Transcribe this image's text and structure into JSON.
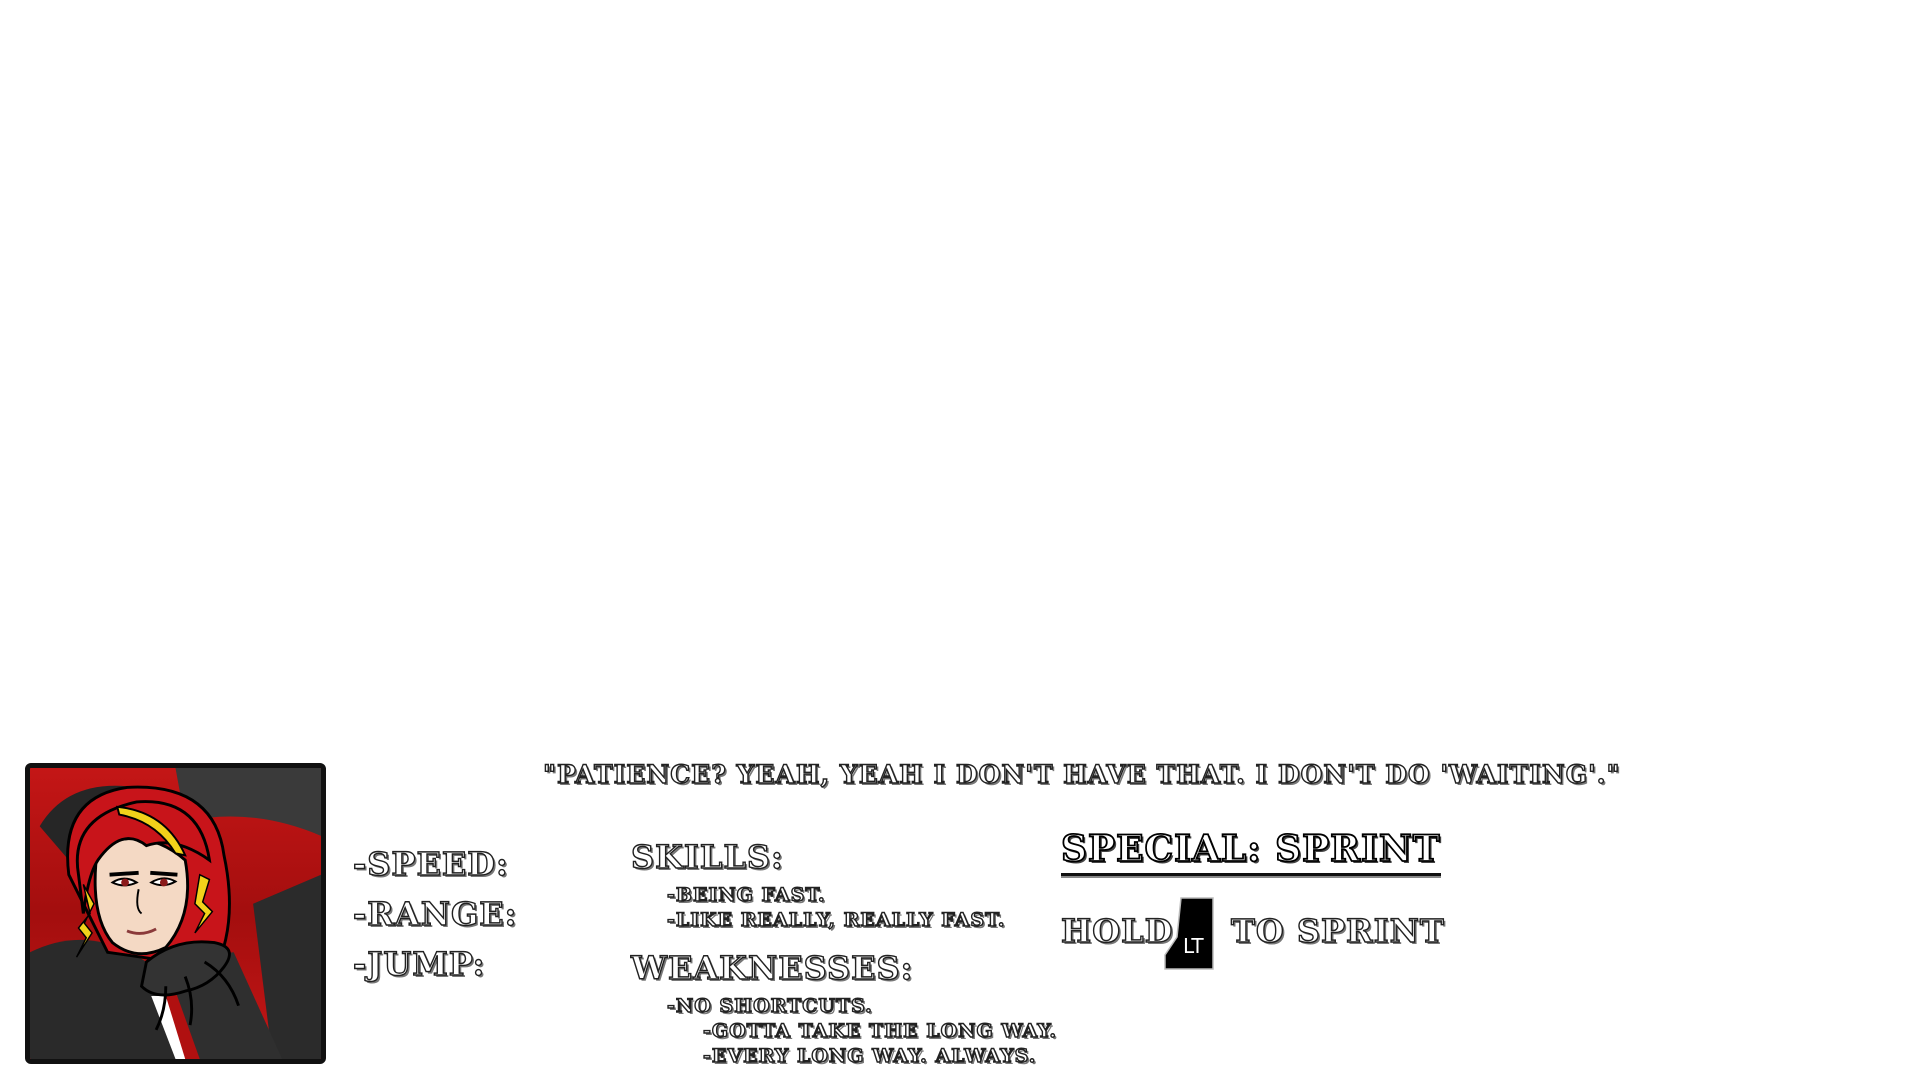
{
  "character": {
    "portrait_icon": "red-haired-character-portrait",
    "quote": "\"Patience? Yeah, yeah I don't have that. I don't do 'waiting'.\""
  },
  "stats": {
    "speed_label": "-Speed:",
    "range_label": "-Range:",
    "jump_label": "-Jump:"
  },
  "skills": {
    "heading": "Skills:",
    "items": [
      "-Being fast.",
      "-Like really, really fast."
    ]
  },
  "weaknesses": {
    "heading": "Weaknesses:",
    "items": [
      "-No shortcuts.",
      "-Gotta take the long way.",
      "-Every long way. Always."
    ]
  },
  "special": {
    "title": "Special: Sprint",
    "hold_label": "Hold",
    "button_label": "LT",
    "button_icon": "left-trigger-icon",
    "action_label": "to Sprint"
  },
  "colors": {
    "portrait_background": "#b01010",
    "hair": "#c8141a",
    "hair_highlight": "#f2d21a",
    "jacket": "#2a2a2a",
    "text_outline": "#222222"
  }
}
